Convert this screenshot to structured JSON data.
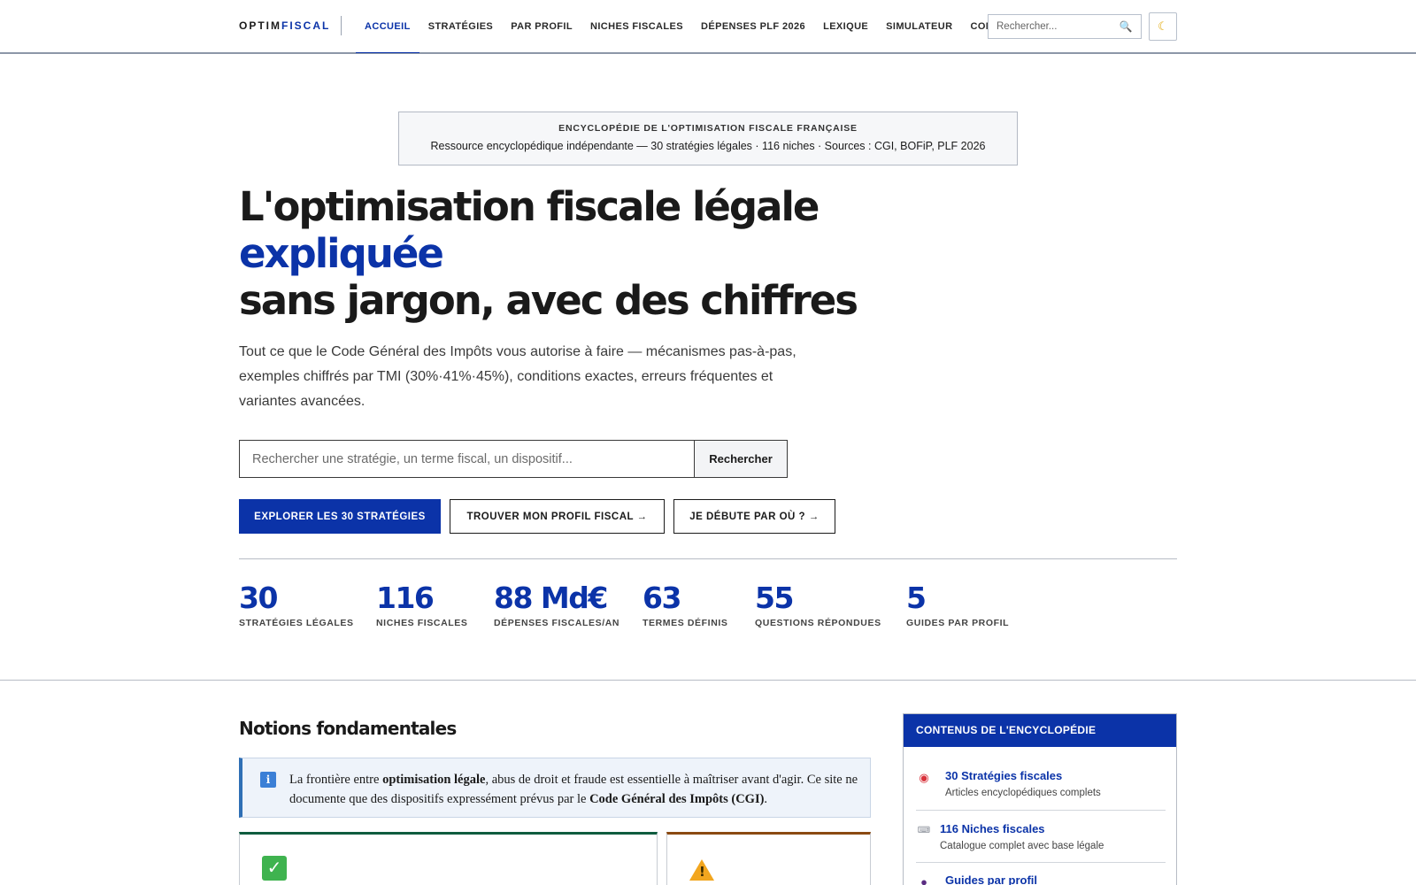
{
  "header": {
    "logo_part1": "OPTIM",
    "logo_part2": "FISCAL",
    "nav": [
      {
        "label": "ACCUEIL",
        "active": true
      },
      {
        "label": "STRATÉGIES",
        "active": false
      },
      {
        "label": "PAR PROFIL",
        "active": false
      },
      {
        "label": "NICHES FISCALES",
        "active": false
      },
      {
        "label": "DÉPENSES PLF 2026",
        "active": false
      },
      {
        "label": "LEXIQUE",
        "active": false
      },
      {
        "label": "SIMULATEUR",
        "active": false
      },
      {
        "label": "COMPARATEUR",
        "active": false
      }
    ],
    "search_placeholder": "Rechercher...",
    "search_icon": "magnifier-icon",
    "theme_icon": "crescent-moon-icon"
  },
  "banner": {
    "kicker": "ENCYCLOPÉDIE DE L'OPTIMISATION FISCALE FRANÇAISE",
    "text": "Ressource encyclopédique indépendante — 30 stratégies légales · 116 niches · Sources : CGI, BOFiP, PLF 2026"
  },
  "hero": {
    "title_line1": "L'optimisation fiscale légale",
    "title_line2": "expliquée",
    "title_line3": "sans jargon, avec des chiffres",
    "subtitle": "Tout ce que le Code Général des Impôts vous autorise à faire — mécanismes pas-à-pas, exemples chiffrés par TMI (30%·41%·45%), conditions exactes, erreurs fréquentes et variantes avancées.",
    "search_placeholder": "Rechercher une stratégie, un terme fiscal, un dispositif...",
    "search_button": "Rechercher",
    "cta_primary": "EXPLORER LES 30 STRATÉGIES",
    "cta_profile": "TROUVER MON PROFIL FISCAL →",
    "cta_start": "JE DÉBUTE PAR OÙ ? →"
  },
  "stats": [
    {
      "value": "30",
      "label": "STRATÉGIES LÉGALES"
    },
    {
      "value": "116",
      "label": "NICHES FISCALES"
    },
    {
      "value": "88 Md€",
      "label": "DÉPENSES FISCALES/AN"
    },
    {
      "value": "63",
      "label": "TERMES DÉFINIS"
    },
    {
      "value": "55",
      "label": "QUESTIONS RÉPONDUES"
    },
    {
      "value": "5",
      "label": "GUIDES PAR PROFIL"
    }
  ],
  "notions": {
    "title": "Notions fondamentales",
    "info_icon": "info-icon",
    "info_part1": "La frontière entre ",
    "info_bold1": "optimisation légale",
    "info_part2": ", abus de droit et fraude est essentielle à maîtriser avant d'agir. Ce site ne documente que des dispositifs expressément prévus par le ",
    "info_bold2": "Code Général des Impôts (CGI)",
    "info_part3": "."
  },
  "sidebar": {
    "title": "CONTENUS DE L'ENCYCLOPÉDIE",
    "items": [
      {
        "icon": "target-icon",
        "title": "30 Stratégies fiscales",
        "desc": "Articles encyclopédiques complets"
      },
      {
        "icon": "ticket-icon",
        "title": "116 Niches fiscales",
        "desc": "Catalogue complet avec base légale"
      },
      {
        "icon": "person-icon",
        "title": "Guides par profil",
        "desc": ""
      }
    ]
  },
  "colors": {
    "brand_blue": "#0b33a8",
    "green_accent": "#0f5c3f",
    "orange_accent": "#8a4a12"
  }
}
